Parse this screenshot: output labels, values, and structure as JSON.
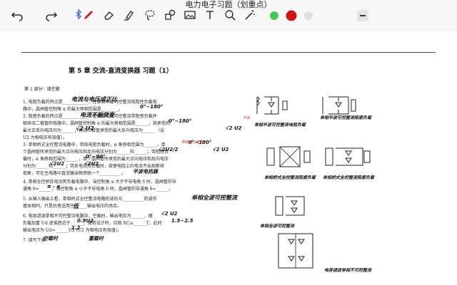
{
  "window": {
    "title": "电力电子习题（划重点）"
  },
  "toolbar": {
    "tools": [
      "undo-icon",
      "redo-icon",
      "bluetooth-icon",
      "pen-icon",
      "eraser-icon",
      "highlighter-icon",
      "lasso-icon",
      "shapes-icon",
      "image-icon",
      "text-icon",
      "zoom-icon",
      "magic-wand-icon"
    ],
    "colors": [
      "#48c75c",
      "#d11414",
      "#e0e0e0"
    ]
  },
  "document": {
    "chapter_title": "第 5 章  交流-直流变换器  习题（1）",
    "section_title": "第 1 部分：填空题",
    "lines": [
      "1. 电阻负载的特点是____________，在单相半波可控整流电阻性负载电",
      "路中，晶闸管控制角 α 的最大移相范围是________。",
      "2. 阻感负载的特点是____________，在单相半波可控整流带阻感负载并",
      "联续流二极管的电路中，晶闸管控制角 α 的最大移相范围是______，其承受的",
      "最大正反向电压均为______，续流二极管承受的最大反向电压为______（设",
      "U2 为相电压有效值）。",
      "3. 单相桥式全控整流电路中，带纯电阻负载时，α 角移相范围为______，单",
      "个晶闸管所承受的最大正向电压和反向电压分别为______和______；带阻感负",
      "载时，α 角移相范围为______，单个晶闸管所承受的最大正向电压和反向电压",
      "分别为______和______；带反电动势负载时，欲使电阻上的电流不出现断续",
      "现象，可在主电路中直流输出侧串联一个__________。",
      "4. 单相全控桥反电动势负载电路中，当控制角 α 大于不导电角 δ 时，晶闸管的导",
      "通角 θ=______；当控制角 α 小于不导电角 δ 时，晶闸管的导通角 θ=______。",
      "5. 从输入输出上看，单相桥式全控整流电路的波形与__________的波形",
      "基本相同，只是后者适用于______输出电压的场合。",
      "6. 电容滤波单相不可控整流电路中，空载时，输出电压为______，随",
      "负载加重 Ud 逐渐趋近于______，通常设计时，应取 RC≥______T，此时",
      "输出电压为 Ud≈______U2 (U2 为相电压有效值)。",
      "7. 填写下表"
    ],
    "handwriting": {
      "h1": "电流与电压成正比",
      "h2": "0°~180°",
      "h3": "电流不能突变",
      "h4": "0°~180°",
      "h5": "√2 U2",
      "h6": "√2 U2",
      "h7": "0°~180°",
      "h8": "√2U2/2",
      "h9": "√2 U2",
      "h10": "0°~90°",
      "h11": "√2U2",
      "h12": "√2U2",
      "h13": "平波电抗器",
      "h14": "π - α",
      "h15": "单相全波可控整流",
      "h16": "低",
      "h17": "√2 U2",
      "h18": "0.9U2",
      "h19": "1.5~2.5",
      "h20": "1.2",
      "h21": "单相半波可控整流电阻负载",
      "h22": "单相半波可控整流阻感负载",
      "h23": "单相桥式全控整流阻感负载",
      "h24": "单相桥式全控整流阻感负载",
      "h25": "单相全波可控整流",
      "h26": "电容滤波单相不可控整流",
      "h27": "空载时",
      "h28": "重载时",
      "h29": "不会",
      "h30": "带续流二极管"
    }
  }
}
